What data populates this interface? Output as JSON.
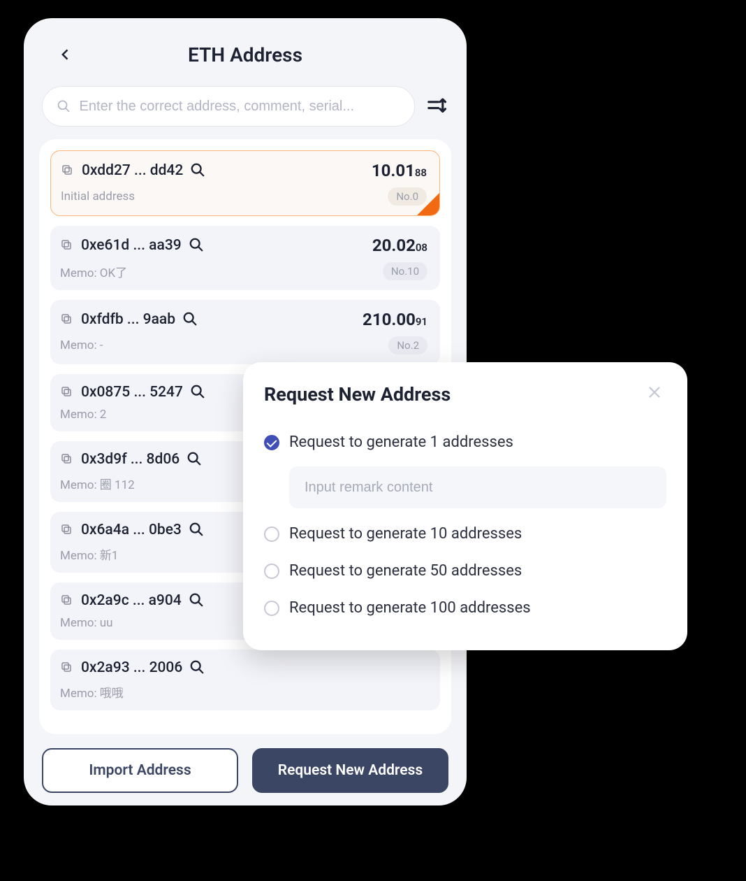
{
  "header": {
    "title": "ETH Address"
  },
  "search": {
    "placeholder": "Enter the correct address, comment, serial..."
  },
  "addresses": [
    {
      "addr": "0xdd27 ... dd42",
      "balance_main": "10.01",
      "balance_sub": "88",
      "memo": "Initial address",
      "badge": "No.0",
      "selected": true
    },
    {
      "addr": "0xe61d ... aa39",
      "balance_main": "20.02",
      "balance_sub": "08",
      "memo": "Memo: OK了",
      "badge": "No.10",
      "selected": false
    },
    {
      "addr": "0xfdfb ... 9aab",
      "balance_main": "210.00",
      "balance_sub": "91",
      "memo": "Memo: -",
      "badge": "No.2",
      "selected": false
    },
    {
      "addr": "0x0875 ... 5247",
      "balance_main": "",
      "balance_sub": "",
      "memo": "Memo: 2",
      "badge": "",
      "selected": false
    },
    {
      "addr": "0x3d9f ... 8d06",
      "balance_main": "",
      "balance_sub": "",
      "memo": "Memo: 圈 112",
      "badge": "",
      "selected": false
    },
    {
      "addr": "0x6a4a ... 0be3",
      "balance_main": "",
      "balance_sub": "",
      "memo": "Memo: 新1",
      "badge": "",
      "selected": false
    },
    {
      "addr": "0x2a9c ... a904",
      "balance_main": "",
      "balance_sub": "",
      "memo": "Memo: uu",
      "badge": "",
      "selected": false
    },
    {
      "addr": "0x2a93 ... 2006",
      "balance_main": "",
      "balance_sub": "",
      "memo": "Memo: 哦哦",
      "badge": "",
      "selected": false
    }
  ],
  "buttons": {
    "import_label": "Import Address",
    "request_label": "Request New Address"
  },
  "modal": {
    "title": "Request New Address",
    "remark_placeholder": "Input remark content",
    "options": [
      {
        "label": "Request to generate 1 addresses",
        "checked": true
      },
      {
        "label": "Request to generate 10 addresses",
        "checked": false
      },
      {
        "label": "Request to generate 50 addresses",
        "checked": false
      },
      {
        "label": "Request to generate 100 addresses",
        "checked": false
      }
    ]
  }
}
